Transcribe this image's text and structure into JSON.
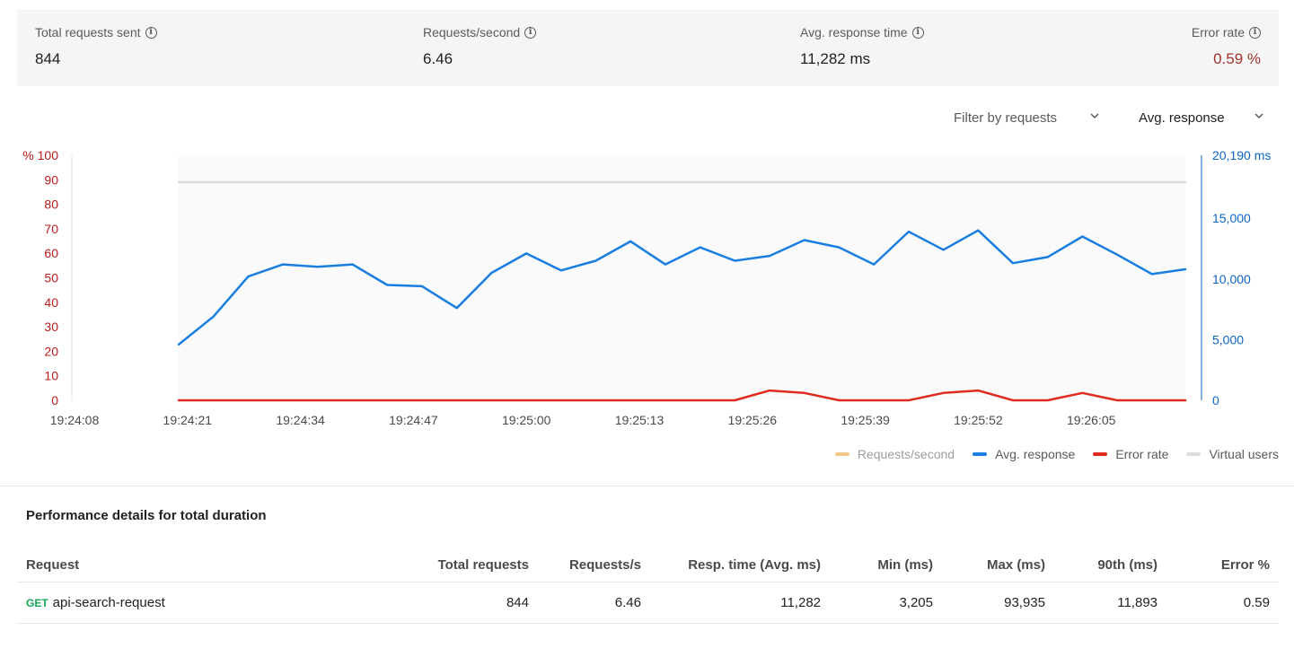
{
  "stats": [
    {
      "label": "Total requests sent",
      "value": "844",
      "value_color": "#212121"
    },
    {
      "label": "Requests/second",
      "value": "6.46",
      "value_color": "#212121"
    },
    {
      "label": "Avg. response time",
      "value": "11,282 ms",
      "value_color": "#212121"
    },
    {
      "label": "Error rate",
      "value": "0.59 %",
      "value_color": "#a0332b"
    }
  ],
  "filters": {
    "requests_filter": "Filter by requests",
    "metric_select": "Avg. response"
  },
  "chart_data": {
    "type": "line",
    "x_tick_labels": [
      "19:24:08",
      "19:24:21",
      "19:24:34",
      "19:24:47",
      "19:25:00",
      "19:25:13",
      "19:25:26",
      "19:25:39",
      "19:25:52",
      "19:26:05"
    ],
    "x_range_seconds": [
      0,
      121
    ],
    "left_axis": {
      "unit_label": "%",
      "ticks": [
        0,
        10,
        20,
        30,
        40,
        50,
        60,
        70,
        80,
        90,
        100
      ],
      "ylim": [
        0,
        100
      ],
      "color": "#b71c1c"
    },
    "right_axis": {
      "ticks": [
        "0",
        "5,000",
        "10,000",
        "15,000",
        "20,190 ms"
      ],
      "tick_values": [
        0,
        5000,
        10000,
        15000,
        20190
      ],
      "ylim": [
        0,
        20190
      ],
      "color": "#0d65c2"
    },
    "grid": false,
    "legend_placement": "bottom-right",
    "series": [
      {
        "name": "Requests/second",
        "color": "#f0c987",
        "axis": "none",
        "x": [],
        "values": []
      },
      {
        "name": "Avg. response",
        "color": "#1a7ee0",
        "axis": "right",
        "x": [
          -3,
          1,
          5,
          9,
          13,
          17,
          21,
          25,
          29,
          33,
          37,
          41,
          45,
          49,
          53,
          57,
          61,
          65,
          69,
          73,
          77,
          81,
          85,
          89,
          93,
          97,
          101,
          105,
          109,
          113
        ],
        "values": [
          4600,
          6900,
          10200,
          11200,
          11000,
          11200,
          9500,
          9400,
          7600,
          10500,
          12100,
          10700,
          11500,
          13100,
          11200,
          12600,
          11500,
          11900,
          13200,
          12600,
          11200,
          13900,
          12400,
          14000,
          11300,
          11800,
          13500,
          12000,
          10400,
          10800
        ]
      },
      {
        "name": "Error rate",
        "color": "#e02a1f",
        "axis": "left",
        "x": [
          -3,
          61,
          65,
          69,
          73,
          77,
          81,
          85,
          89,
          93,
          97,
          101,
          105,
          109,
          113
        ],
        "values": [
          0,
          0,
          4,
          3,
          0,
          0,
          0,
          3,
          4,
          0,
          0,
          3,
          0,
          0,
          0
        ]
      },
      {
        "name": "Virtual users",
        "color": "#dddddd",
        "axis": "left",
        "x": [
          -3,
          113
        ],
        "values": [
          89,
          89
        ]
      }
    ]
  },
  "table": {
    "title": "Performance details for total duration",
    "headers": [
      "Request",
      "Total requests",
      "Requests/s",
      "Resp. time (Avg. ms)",
      "Min (ms)",
      "Max (ms)",
      "90th (ms)",
      "Error %"
    ],
    "rows": [
      {
        "method": "GET",
        "name": "api-search-request",
        "total": "844",
        "rps": "6.46",
        "avg": "11,282",
        "min": "3,205",
        "max": "93,935",
        "p90": "11,893",
        "err": "0.59"
      }
    ]
  }
}
